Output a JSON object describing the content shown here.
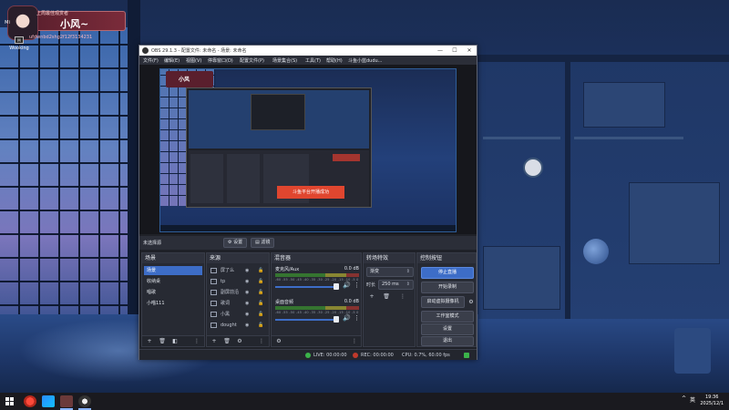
{
  "overlay": {
    "top_line": "上周最佳观赏者",
    "name": "小风~",
    "bottom_line": "ufdwnbd2shg2f12f3134231"
  },
  "desktop_icons": [
    {
      "label": "Mi"
    },
    {
      "label": "Wooking"
    }
  ],
  "obs": {
    "title": "OBS 29.1.3 - 配置文件: 未命名 - 场景: 未命名",
    "window_controls": {
      "minimize": "—",
      "maximize": "☐",
      "close": "✕"
    },
    "menu": [
      "文件(F)",
      "编辑(E)",
      "视图(V)",
      "停靠窗口(D)",
      "配置文件(P)",
      "场景集合(S)",
      "工具(T)",
      "帮助(H)",
      "斗鱼小蓝dudu..."
    ],
    "preview": {
      "mini_overlay_name": "小风",
      "toast": "斗鱼平台开播成功"
    },
    "scene_bar": {
      "current": "未选择源",
      "settings_label": "设置",
      "filters_label": "滤镜"
    },
    "docks": {
      "scenes": {
        "title": "场景",
        "items": [
          "场景",
          "收纳桌",
          "唱歌",
          "小喵111"
        ],
        "selected_index": 0
      },
      "sources": {
        "title": "来源",
        "items": [
          "屏了么",
          "tp",
          "副屏前沿",
          "歌词",
          "小黑",
          "dought"
        ]
      },
      "mixer": {
        "title": "混音器",
        "channels": [
          {
            "name": "麦克风/Aux",
            "db": "0.0 dB",
            "level": 0.72
          },
          {
            "name": "桌面音频",
            "db": "0.0 dB",
            "level": 0.72
          }
        ],
        "scale": "-60 -55 -50 -45 -40 -35 -30 -25 -20 -15 -10 -5 0"
      },
      "transitions": {
        "title": "转场特效",
        "type": "渐变",
        "duration_label": "时长",
        "duration_value": "250 ms"
      },
      "controls": {
        "title": "控制按钮",
        "buttons": [
          "停止直播",
          "开始录制",
          "启动虚拟摄像机",
          "工作室模式",
          "设置",
          "退出"
        ]
      }
    },
    "status": {
      "live": "LIVE: 00:00:00",
      "rec": "REC: 00:00:00",
      "cpu": "CPU: 0.7%, 60.00 fps"
    }
  },
  "taskbar": {
    "tray_lang": "英",
    "time": "19:36",
    "date": "2025/12/1"
  },
  "colors": {
    "accent": "#3d6dc7",
    "live_dot": "#3bb34a",
    "rec_dot": "#c0392b",
    "toast": "#e0462f"
  }
}
